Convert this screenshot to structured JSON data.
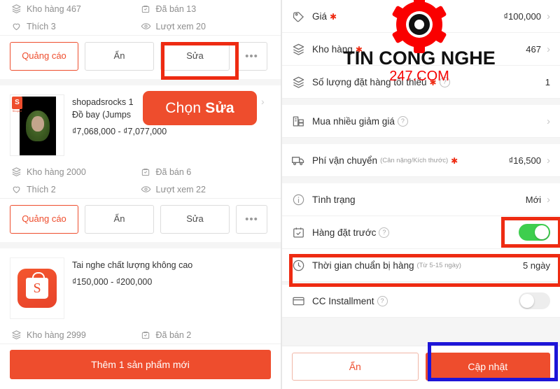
{
  "left_panel": {
    "product_1": {
      "stats": [
        {
          "icon": "stack-icon",
          "text": "Kho hàng 467"
        },
        {
          "icon": "sold-box-icon",
          "text": "Đã bán 13"
        },
        {
          "icon": "heart-icon",
          "text": "Thích 3"
        },
        {
          "icon": "eye-icon",
          "text": "Lượt xem 20"
        }
      ],
      "buttons": {
        "ads": "Quảng cáo",
        "hide": "Ẩn",
        "edit": "Sửa",
        "more": "•••"
      }
    },
    "product_2": {
      "name_line1": "shopadsrocks 1",
      "name_line2": "Đồ bay (Jumps",
      "price": "₫7,068,000 - ₫7,077,000",
      "stats": [
        {
          "icon": "stack-icon",
          "text": "Kho hàng 2000"
        },
        {
          "icon": "sold-box-icon",
          "text": "Đã bán 6"
        },
        {
          "icon": "heart-icon",
          "text": "Thích 2"
        },
        {
          "icon": "eye-icon",
          "text": "Lượt xem 22"
        }
      ],
      "buttons": {
        "ads": "Quảng cáo",
        "hide": "Ẩn",
        "edit": "Sửa",
        "more": "•••"
      }
    },
    "product_3": {
      "name": "Tai nghe chất lượng không cao",
      "price": "₫150,000 - ₫200,000",
      "stats": [
        {
          "icon": "stack-icon",
          "text": "Kho hàng 2999"
        },
        {
          "icon": "sold-box-icon",
          "text": "Đã bán 2"
        }
      ]
    },
    "add_product_button": "Thêm 1 sản phẩm mới",
    "callout": {
      "prefix": "Chọn",
      "emphasis": "Sửa"
    }
  },
  "right_panel": {
    "rows": [
      {
        "icon": "price-tag-icon",
        "label": "Giá",
        "required": true,
        "value": "₫100,000",
        "chevron": true
      },
      {
        "icon": "stack-icon",
        "label": "Kho hàng",
        "required": true,
        "value": "467",
        "chevron": true
      },
      {
        "icon": "stack-icon",
        "label": "Số lượng đặt hàng tối thiểu",
        "required": true,
        "help": true,
        "value": "1",
        "chevron": false
      },
      {
        "icon": "wholesale-icon",
        "label": "Mua nhiều giảm giá",
        "help": true,
        "value": "",
        "chevron": true
      },
      {
        "icon": "truck-icon",
        "label": "Phí vận chuyển",
        "hint": "(Cân nặng/Kích thước)",
        "required": true,
        "value": "₫16,500",
        "chevron": true
      },
      {
        "icon": "info-icon",
        "label": "Tình trạng",
        "value": "Mới",
        "chevron": true
      },
      {
        "icon": "calendar-check-icon",
        "label": "Hàng đặt trước",
        "help": true,
        "toggle": "on"
      },
      {
        "icon": "clock-icon",
        "label": "Thời gian chuẩn bị hàng",
        "hint": "(Từ 5-15 ngày)",
        "value": "5 ngày",
        "chevron": false
      },
      {
        "icon": "card-icon",
        "label": "CC Installment",
        "help": true,
        "toggle": "off"
      }
    ],
    "footer": {
      "hide_button": "Ẩn",
      "update_button": "Cập nhật"
    }
  },
  "watermark": {
    "icon": "gear-icon",
    "title": "TIN CONG NGHE",
    "subtitle": "247.COM"
  },
  "colors": {
    "brand_orange": "#ee4d2d",
    "highlight_red": "#ee2b12",
    "highlight_blue": "#1d15d8",
    "toggle_green": "#3ece4e",
    "required_red": "#ee2b12"
  }
}
